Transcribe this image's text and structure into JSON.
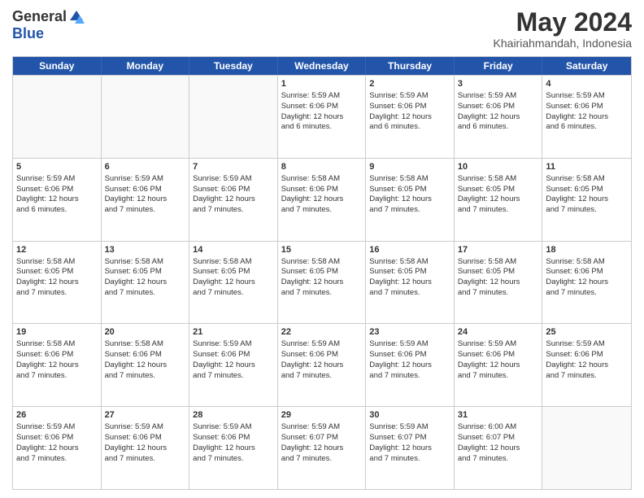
{
  "logo": {
    "general": "General",
    "blue": "Blue"
  },
  "header": {
    "month": "May 2024",
    "location": "Khairiahmandah, Indonesia"
  },
  "days": [
    "Sunday",
    "Monday",
    "Tuesday",
    "Wednesday",
    "Thursday",
    "Friday",
    "Saturday"
  ],
  "rows": [
    [
      {
        "day": "",
        "lines": []
      },
      {
        "day": "",
        "lines": []
      },
      {
        "day": "",
        "lines": []
      },
      {
        "day": "1",
        "lines": [
          "Sunrise: 5:59 AM",
          "Sunset: 6:06 PM",
          "Daylight: 12 hours",
          "and 6 minutes."
        ]
      },
      {
        "day": "2",
        "lines": [
          "Sunrise: 5:59 AM",
          "Sunset: 6:06 PM",
          "Daylight: 12 hours",
          "and 6 minutes."
        ]
      },
      {
        "day": "3",
        "lines": [
          "Sunrise: 5:59 AM",
          "Sunset: 6:06 PM",
          "Daylight: 12 hours",
          "and 6 minutes."
        ]
      },
      {
        "day": "4",
        "lines": [
          "Sunrise: 5:59 AM",
          "Sunset: 6:06 PM",
          "Daylight: 12 hours",
          "and 6 minutes."
        ]
      }
    ],
    [
      {
        "day": "5",
        "lines": [
          "Sunrise: 5:59 AM",
          "Sunset: 6:06 PM",
          "Daylight: 12 hours",
          "and 6 minutes."
        ]
      },
      {
        "day": "6",
        "lines": [
          "Sunrise: 5:59 AM",
          "Sunset: 6:06 PM",
          "Daylight: 12 hours",
          "and 7 minutes."
        ]
      },
      {
        "day": "7",
        "lines": [
          "Sunrise: 5:59 AM",
          "Sunset: 6:06 PM",
          "Daylight: 12 hours",
          "and 7 minutes."
        ]
      },
      {
        "day": "8",
        "lines": [
          "Sunrise: 5:58 AM",
          "Sunset: 6:06 PM",
          "Daylight: 12 hours",
          "and 7 minutes."
        ]
      },
      {
        "day": "9",
        "lines": [
          "Sunrise: 5:58 AM",
          "Sunset: 6:05 PM",
          "Daylight: 12 hours",
          "and 7 minutes."
        ]
      },
      {
        "day": "10",
        "lines": [
          "Sunrise: 5:58 AM",
          "Sunset: 6:05 PM",
          "Daylight: 12 hours",
          "and 7 minutes."
        ]
      },
      {
        "day": "11",
        "lines": [
          "Sunrise: 5:58 AM",
          "Sunset: 6:05 PM",
          "Daylight: 12 hours",
          "and 7 minutes."
        ]
      }
    ],
    [
      {
        "day": "12",
        "lines": [
          "Sunrise: 5:58 AM",
          "Sunset: 6:05 PM",
          "Daylight: 12 hours",
          "and 7 minutes."
        ]
      },
      {
        "day": "13",
        "lines": [
          "Sunrise: 5:58 AM",
          "Sunset: 6:05 PM",
          "Daylight: 12 hours",
          "and 7 minutes."
        ]
      },
      {
        "day": "14",
        "lines": [
          "Sunrise: 5:58 AM",
          "Sunset: 6:05 PM",
          "Daylight: 12 hours",
          "and 7 minutes."
        ]
      },
      {
        "day": "15",
        "lines": [
          "Sunrise: 5:58 AM",
          "Sunset: 6:05 PM",
          "Daylight: 12 hours",
          "and 7 minutes."
        ]
      },
      {
        "day": "16",
        "lines": [
          "Sunrise: 5:58 AM",
          "Sunset: 6:05 PM",
          "Daylight: 12 hours",
          "and 7 minutes."
        ]
      },
      {
        "day": "17",
        "lines": [
          "Sunrise: 5:58 AM",
          "Sunset: 6:05 PM",
          "Daylight: 12 hours",
          "and 7 minutes."
        ]
      },
      {
        "day": "18",
        "lines": [
          "Sunrise: 5:58 AM",
          "Sunset: 6:06 PM",
          "Daylight: 12 hours",
          "and 7 minutes."
        ]
      }
    ],
    [
      {
        "day": "19",
        "lines": [
          "Sunrise: 5:58 AM",
          "Sunset: 6:06 PM",
          "Daylight: 12 hours",
          "and 7 minutes."
        ]
      },
      {
        "day": "20",
        "lines": [
          "Sunrise: 5:58 AM",
          "Sunset: 6:06 PM",
          "Daylight: 12 hours",
          "and 7 minutes."
        ]
      },
      {
        "day": "21",
        "lines": [
          "Sunrise: 5:59 AM",
          "Sunset: 6:06 PM",
          "Daylight: 12 hours",
          "and 7 minutes."
        ]
      },
      {
        "day": "22",
        "lines": [
          "Sunrise: 5:59 AM",
          "Sunset: 6:06 PM",
          "Daylight: 12 hours",
          "and 7 minutes."
        ]
      },
      {
        "day": "23",
        "lines": [
          "Sunrise: 5:59 AM",
          "Sunset: 6:06 PM",
          "Daylight: 12 hours",
          "and 7 minutes."
        ]
      },
      {
        "day": "24",
        "lines": [
          "Sunrise: 5:59 AM",
          "Sunset: 6:06 PM",
          "Daylight: 12 hours",
          "and 7 minutes."
        ]
      },
      {
        "day": "25",
        "lines": [
          "Sunrise: 5:59 AM",
          "Sunset: 6:06 PM",
          "Daylight: 12 hours",
          "and 7 minutes."
        ]
      }
    ],
    [
      {
        "day": "26",
        "lines": [
          "Sunrise: 5:59 AM",
          "Sunset: 6:06 PM",
          "Daylight: 12 hours",
          "and 7 minutes."
        ]
      },
      {
        "day": "27",
        "lines": [
          "Sunrise: 5:59 AM",
          "Sunset: 6:06 PM",
          "Daylight: 12 hours",
          "and 7 minutes."
        ]
      },
      {
        "day": "28",
        "lines": [
          "Sunrise: 5:59 AM",
          "Sunset: 6:06 PM",
          "Daylight: 12 hours",
          "and 7 minutes."
        ]
      },
      {
        "day": "29",
        "lines": [
          "Sunrise: 5:59 AM",
          "Sunset: 6:07 PM",
          "Daylight: 12 hours",
          "and 7 minutes."
        ]
      },
      {
        "day": "30",
        "lines": [
          "Sunrise: 5:59 AM",
          "Sunset: 6:07 PM",
          "Daylight: 12 hours",
          "and 7 minutes."
        ]
      },
      {
        "day": "31",
        "lines": [
          "Sunrise: 6:00 AM",
          "Sunset: 6:07 PM",
          "Daylight: 12 hours",
          "and 7 minutes."
        ]
      },
      {
        "day": "",
        "lines": []
      }
    ]
  ]
}
